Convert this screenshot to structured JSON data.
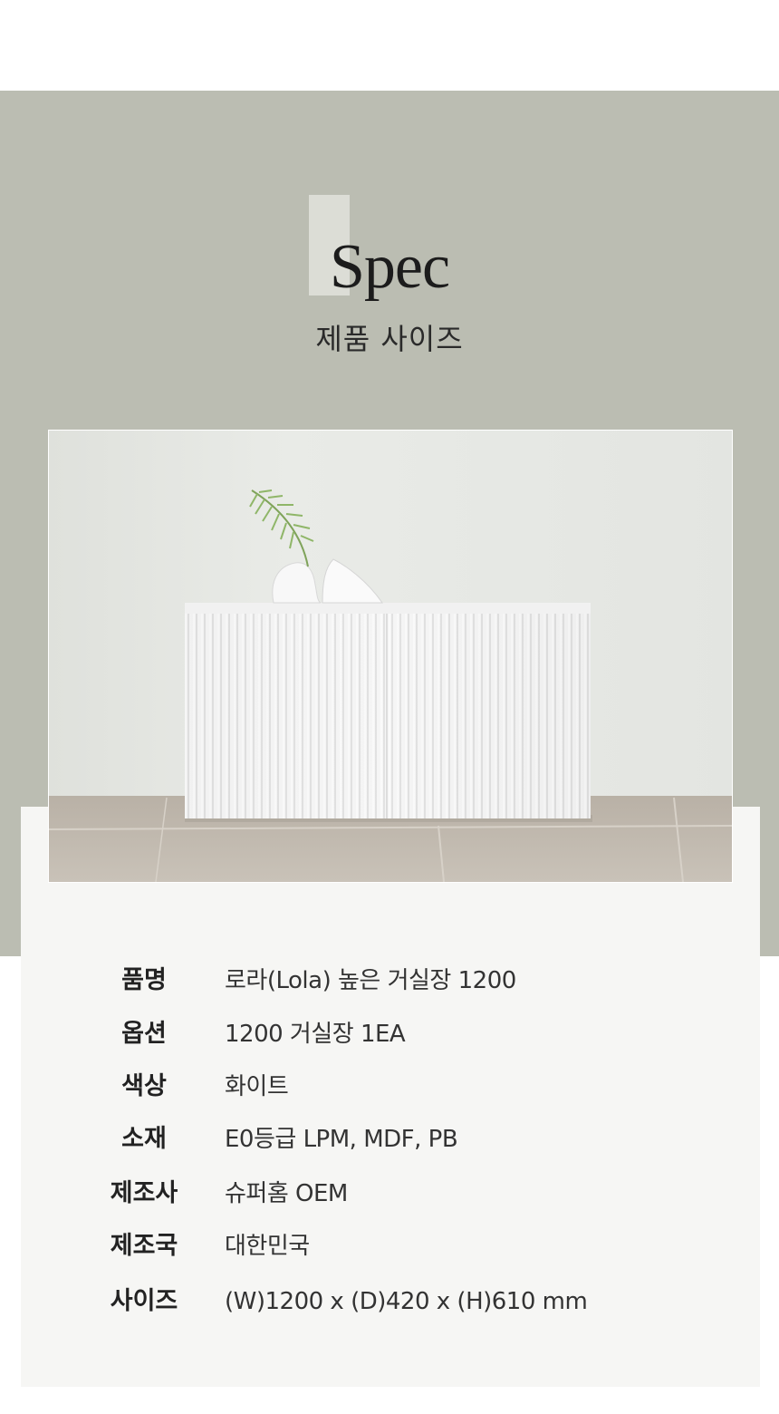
{
  "header": {
    "title": "Spec",
    "subtitle": "제품 사이즈"
  },
  "product_image": {
    "icon": "product-photo-sideboard-with-vase"
  },
  "specs": [
    {
      "label": "품명",
      "value": "로라(Lola) 높은 거실장 1200"
    },
    {
      "label": "옵션",
      "value": "1200 거실장 1EA"
    },
    {
      "label": "색상",
      "value": "화이트"
    },
    {
      "label": "소재",
      "value": "E0등급 LPM, MDF, PB"
    },
    {
      "label": "제조사",
      "value": "슈퍼홈 OEM"
    },
    {
      "label": "제조국",
      "value": "대한민국"
    },
    {
      "label": "사이즈",
      "value": "(W)1200 x (D)420 x (H)610 mm"
    }
  ],
  "colors": {
    "band": "#bbbdb2",
    "card": "#f6f6f4",
    "accent_bar": "#dcddd6"
  }
}
